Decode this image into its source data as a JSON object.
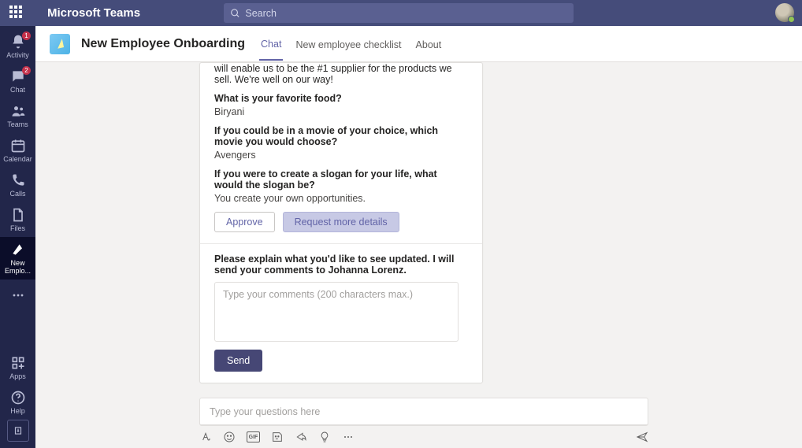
{
  "topbar": {
    "brand": "Microsoft Teams",
    "search_placeholder": "Search"
  },
  "rail": {
    "activity": "Activity",
    "activity_badge": "1",
    "chat": "Chat",
    "chat_badge": "2",
    "teams": "Teams",
    "calendar": "Calendar",
    "calls": "Calls",
    "files": "Files",
    "newemp": "New Emplo...",
    "apps": "Apps",
    "help": "Help"
  },
  "header": {
    "title": "New Employee Onboarding",
    "tab_chat": "Chat",
    "tab_checklist": "New employee checklist",
    "tab_about": "About"
  },
  "card": {
    "intro": "will enable us to be the #1 supplier for the products we sell. We're well on our way!",
    "q1": "What is your favorite food?",
    "a1": "Biryani",
    "q2": "If you could be in a movie of your choice, which movie you would choose?",
    "a2": "Avengers",
    "q3": "If you were to create a slogan for your life, what would the slogan be?",
    "a3": "You create your own opportunities.",
    "approve": "Approve",
    "request": "Request more details",
    "explain": "Please explain what you'd like to see updated. I will send your comments to Johanna Lorenz.",
    "comment_placeholder": "Type your comments (200 characters max.)",
    "send": "Send"
  },
  "compose": {
    "placeholder": "Type your questions here",
    "gif": "GIF"
  }
}
